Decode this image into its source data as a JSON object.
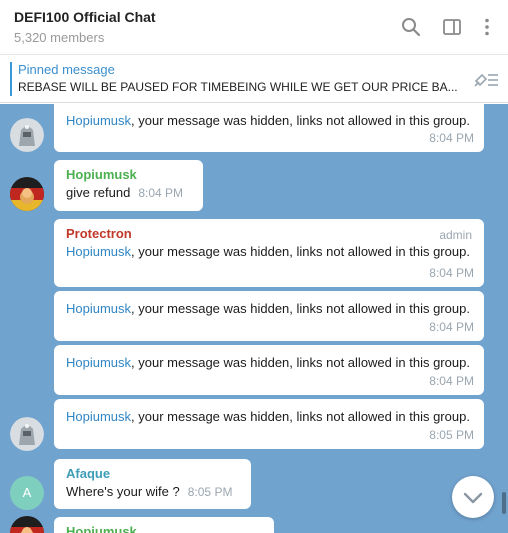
{
  "header": {
    "title": "DEFI100 Official Chat",
    "members": "5,320 members",
    "icons": [
      "search-icon",
      "sidebar-toggle-icon",
      "more-vertical-icon"
    ]
  },
  "pinned": {
    "label": "Pinned message",
    "text": "REBASE WILL BE PAUSED FOR TIMEBEING WHILE WE GET OUR PRICE BA..."
  },
  "colors": {
    "chat_bg": "#71a3cf",
    "mention": "#2f86c5",
    "sender_green": "#4caf50",
    "sender_red": "#c0392b",
    "sender_teal": "#3d9db7"
  },
  "messages": [
    {
      "mention": "Hopiumusk",
      "text": ", your message was hidden, links not allowed in this group.",
      "time": "8:04 PM"
    },
    {
      "sender": "Hopiumusk",
      "text": "give refund",
      "time": "8:04 PM"
    },
    {
      "sender": "Protectron",
      "badge": "admin",
      "mention": "Hopiumusk",
      "text": ", your message was hidden, links not allowed in this group.",
      "time": "8:04 PM"
    },
    {
      "mention": "Hopiumusk",
      "text": ", your message was hidden, links not allowed in this group.",
      "time": "8:04 PM"
    },
    {
      "mention": "Hopiumusk",
      "text": ", your message was hidden, links not allowed in this group.",
      "time": "8:04 PM"
    },
    {
      "mention": "Hopiumusk",
      "text": ", your message was hidden, links not allowed in this group.",
      "time": "8:05 PM"
    },
    {
      "sender": "Afaque",
      "avatar_letter": "A",
      "text": "Where's your wife ?",
      "time": "8:05 PM"
    },
    {
      "sender": "Hopiumusk"
    }
  ]
}
